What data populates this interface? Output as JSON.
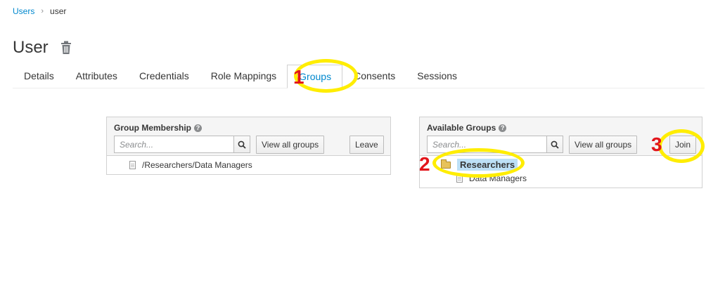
{
  "breadcrumb": {
    "root": "Users",
    "current": "user"
  },
  "page": {
    "title": "User"
  },
  "tabs": [
    {
      "label": "Details"
    },
    {
      "label": "Attributes"
    },
    {
      "label": "Credentials"
    },
    {
      "label": "Role Mappings"
    },
    {
      "label": "Groups"
    },
    {
      "label": "Consents"
    },
    {
      "label": "Sessions"
    }
  ],
  "active_tab": "Groups",
  "group_membership": {
    "title": "Group Membership",
    "search_placeholder": "Search...",
    "view_all_label": "View all groups",
    "leave_label": "Leave",
    "items": [
      "/Researchers/Data Managers"
    ]
  },
  "available_groups": {
    "title": "Available Groups",
    "search_placeholder": "Search...",
    "view_all_label": "View all groups",
    "join_label": "Join",
    "selected_group": "Researchers",
    "child_group": "Data Managers"
  },
  "annotations": [
    "1",
    "2",
    "3"
  ],
  "colors": {
    "link": "#0088ce",
    "annotation_ring": "#ffed00",
    "annotation_number": "#e2151b",
    "selection": "#bde0f6"
  }
}
